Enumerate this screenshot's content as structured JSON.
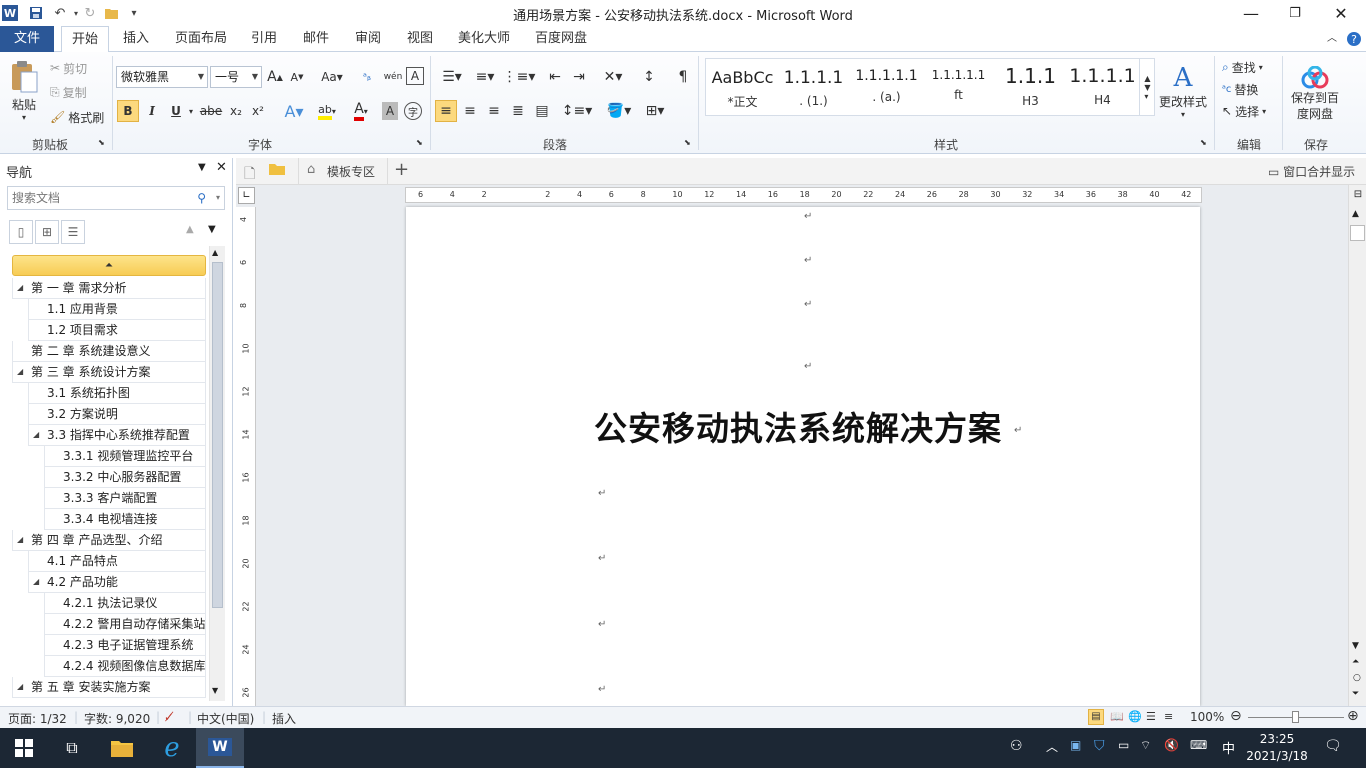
{
  "window": {
    "title": "通用场景方案 - 公安移动执法系统.docx  -  Microsoft Word",
    "app_icon": "W"
  },
  "ribbon_tabs": [
    "文件",
    "开始",
    "插入",
    "页面布局",
    "引用",
    "邮件",
    "审阅",
    "视图",
    "美化大师",
    "百度网盘"
  ],
  "ribbon": {
    "clipboard": {
      "paste": "粘贴",
      "cut": "剪切",
      "copy": "复制",
      "format_painter": "格式刷",
      "label": "剪贴板"
    },
    "font": {
      "name": "微软雅黑",
      "size": "一号",
      "label": "字体",
      "bold": "B",
      "italic": "I",
      "underline": "U",
      "strike": "abe",
      "sub": "x₂",
      "sup": "x²"
    },
    "paragraph": {
      "label": "段落"
    },
    "styles": {
      "label": "样式",
      "items": [
        {
          "sample": "AaBbCc",
          "name": "*正文"
        },
        {
          "sample": "1.1.1.1",
          "name": ". (1.)"
        },
        {
          "sample": "1.1.1.1.1",
          "name": ". (a.)"
        },
        {
          "sample": "1.1.1.1.1",
          "name": "ft"
        },
        {
          "sample": "1.1.1",
          "name": "H3"
        },
        {
          "sample": "1.1.1.1",
          "name": "H4"
        }
      ],
      "change_styles": "更改样式"
    },
    "editing": {
      "find": "查找",
      "replace": "替换",
      "select": "选择",
      "label": "编辑"
    },
    "save": {
      "save_baidu": "保存到百度网盘",
      "label": "保存"
    }
  },
  "doc_tabs": {
    "template": "模板专区",
    "merge_windows": "窗口合并显示"
  },
  "nav": {
    "title": "导航",
    "search_placeholder": "搜索文档",
    "items": [
      {
        "text": "第 一 章  需求分析",
        "level": 1,
        "expanded": true
      },
      {
        "text": "1.1 应用背景",
        "level": 2,
        "expanded": false
      },
      {
        "text": "1.2 项目需求",
        "level": 2,
        "expanded": false
      },
      {
        "text": "第 二 章  系统建设意义",
        "level": 1,
        "expanded": false
      },
      {
        "text": "第 三 章  系统设计方案",
        "level": 1,
        "expanded": true
      },
      {
        "text": "3.1 系统拓扑图",
        "level": 2,
        "expanded": false
      },
      {
        "text": "3.2 方案说明",
        "level": 2,
        "expanded": false
      },
      {
        "text": "3.3 指挥中心系统推荐配置",
        "level": 2,
        "expanded": true
      },
      {
        "text": "3.3.1 视频管理监控平台",
        "level": 3,
        "expanded": false
      },
      {
        "text": "3.3.2 中心服务器配置",
        "level": 3,
        "expanded": false
      },
      {
        "text": "3.3.3 客户端配置",
        "level": 3,
        "expanded": false
      },
      {
        "text": "3.3.4 电视墙连接",
        "level": 3,
        "expanded": false
      },
      {
        "text": "第 四 章  产品选型、介绍",
        "level": 1,
        "expanded": true
      },
      {
        "text": "4.1 产品特点",
        "level": 2,
        "expanded": false
      },
      {
        "text": "4.2 产品功能",
        "level": 2,
        "expanded": true
      },
      {
        "text": "4.2.1 执法记录仪",
        "level": 3,
        "expanded": false
      },
      {
        "text": "4.2.2 警用自动存储采集站",
        "level": 3,
        "expanded": false
      },
      {
        "text": "4.2.3 电子证据管理系统",
        "level": 3,
        "expanded": false
      },
      {
        "text": "4.2.4 视频图像信息数据库",
        "level": 3,
        "expanded": false
      },
      {
        "text": "第 五 章  安装实施方案",
        "level": 1,
        "expanded": true
      }
    ]
  },
  "document": {
    "title": "公安移动执法系统解决方案",
    "para_mark": "↵"
  },
  "ruler": {
    "h_ticks": [
      "6",
      "4",
      "2",
      "",
      "2",
      "4",
      "6",
      "8",
      "10",
      "12",
      "14",
      "16",
      "18",
      "20",
      "22",
      "24",
      "26",
      "28",
      "30",
      "32",
      "34",
      "36",
      "38",
      "40",
      "42"
    ],
    "v_ticks": [
      "4",
      "6",
      "8",
      "10",
      "12",
      "14",
      "16",
      "18",
      "20",
      "22",
      "24",
      "26"
    ]
  },
  "status": {
    "page": "页面: 1/32",
    "words": "字数: 9,020",
    "language": "中文(中国)",
    "mode": "插入",
    "zoom": "100%"
  },
  "taskbar": {
    "time": "23:25",
    "date": "2021/3/18",
    "ime": "中"
  },
  "colors": {
    "file_tab": "#2b5797",
    "nav_highlight": "#f7cc55",
    "taskbar": "#1c2734"
  }
}
